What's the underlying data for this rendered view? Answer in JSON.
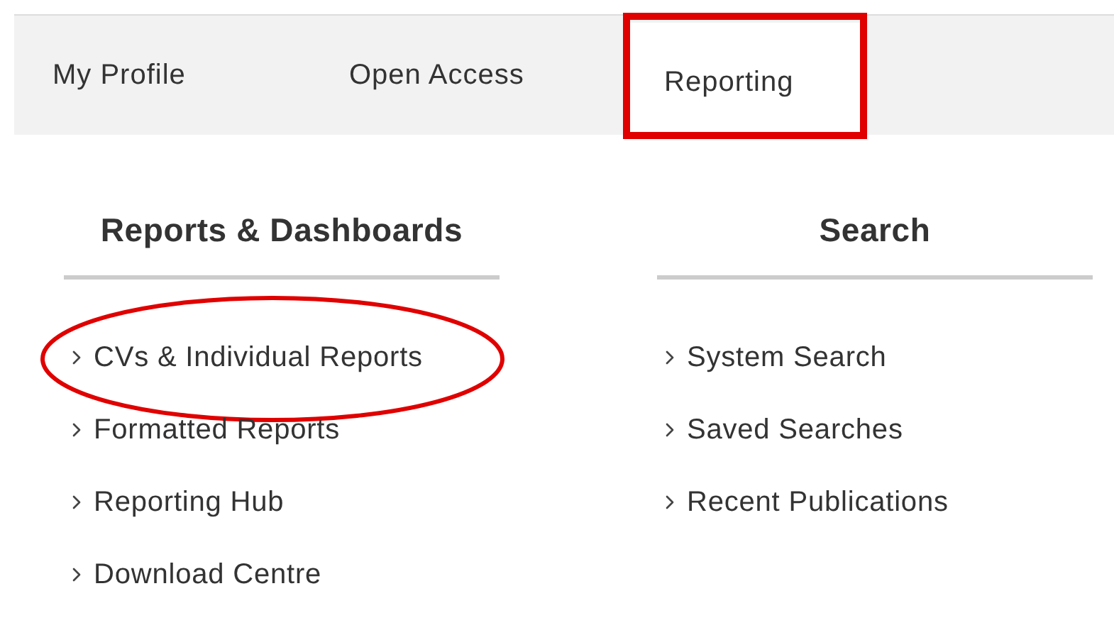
{
  "tabs": [
    {
      "label": "My Profile",
      "selected": false,
      "highlighted": false
    },
    {
      "label": "Open Access",
      "selected": false,
      "highlighted": false
    },
    {
      "label": "Reporting",
      "selected": true,
      "highlighted": true
    }
  ],
  "columns": [
    {
      "heading": "Reports & Dashboards",
      "items": [
        {
          "label": "CVs & Individual Reports",
          "highlighted": true
        },
        {
          "label": "Formatted Reports",
          "highlighted": false
        },
        {
          "label": "Reporting Hub",
          "highlighted": false
        },
        {
          "label": "Download Centre",
          "highlighted": false
        }
      ]
    },
    {
      "heading": "Search",
      "items": [
        {
          "label": "System Search",
          "highlighted": false
        },
        {
          "label": "Saved Searches",
          "highlighted": false
        },
        {
          "label": "Recent Publications",
          "highlighted": false
        }
      ]
    }
  ]
}
